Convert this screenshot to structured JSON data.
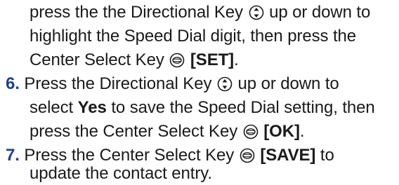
{
  "instructions": {
    "continued": {
      "lines": [
        {
          "parts": [
            "press the the Directional Key ",
            " up or down to"
          ]
        },
        {
          "parts": [
            "highlight the Speed Dial digit, then press the"
          ]
        },
        {
          "parts": [
            "Center Select Key ",
            " ",
            "[SET]",
            "."
          ]
        }
      ]
    },
    "step6": {
      "number": "6.",
      "lines": [
        {
          "parts": [
            "Press the Directional Key ",
            " up or down to"
          ]
        },
        {
          "parts": [
            "select ",
            "Yes",
            " to save the Speed Dial setting, then"
          ]
        },
        {
          "parts": [
            "press the Center Select Key ",
            " ",
            "[OK]",
            "."
          ]
        }
      ]
    },
    "step7": {
      "number": "7.",
      "lines": [
        {
          "parts": [
            "Press the Center Select Key ",
            " ",
            "[SAVE]",
            " to"
          ]
        },
        {
          "parts": [
            "update the contact entry."
          ]
        }
      ]
    }
  },
  "icons": {
    "directional_key": "directional-key-icon",
    "center_select_key": "center-select-key-icon"
  },
  "colors": {
    "step_number": "#1f3f8f",
    "text": "#1a1a1a"
  }
}
